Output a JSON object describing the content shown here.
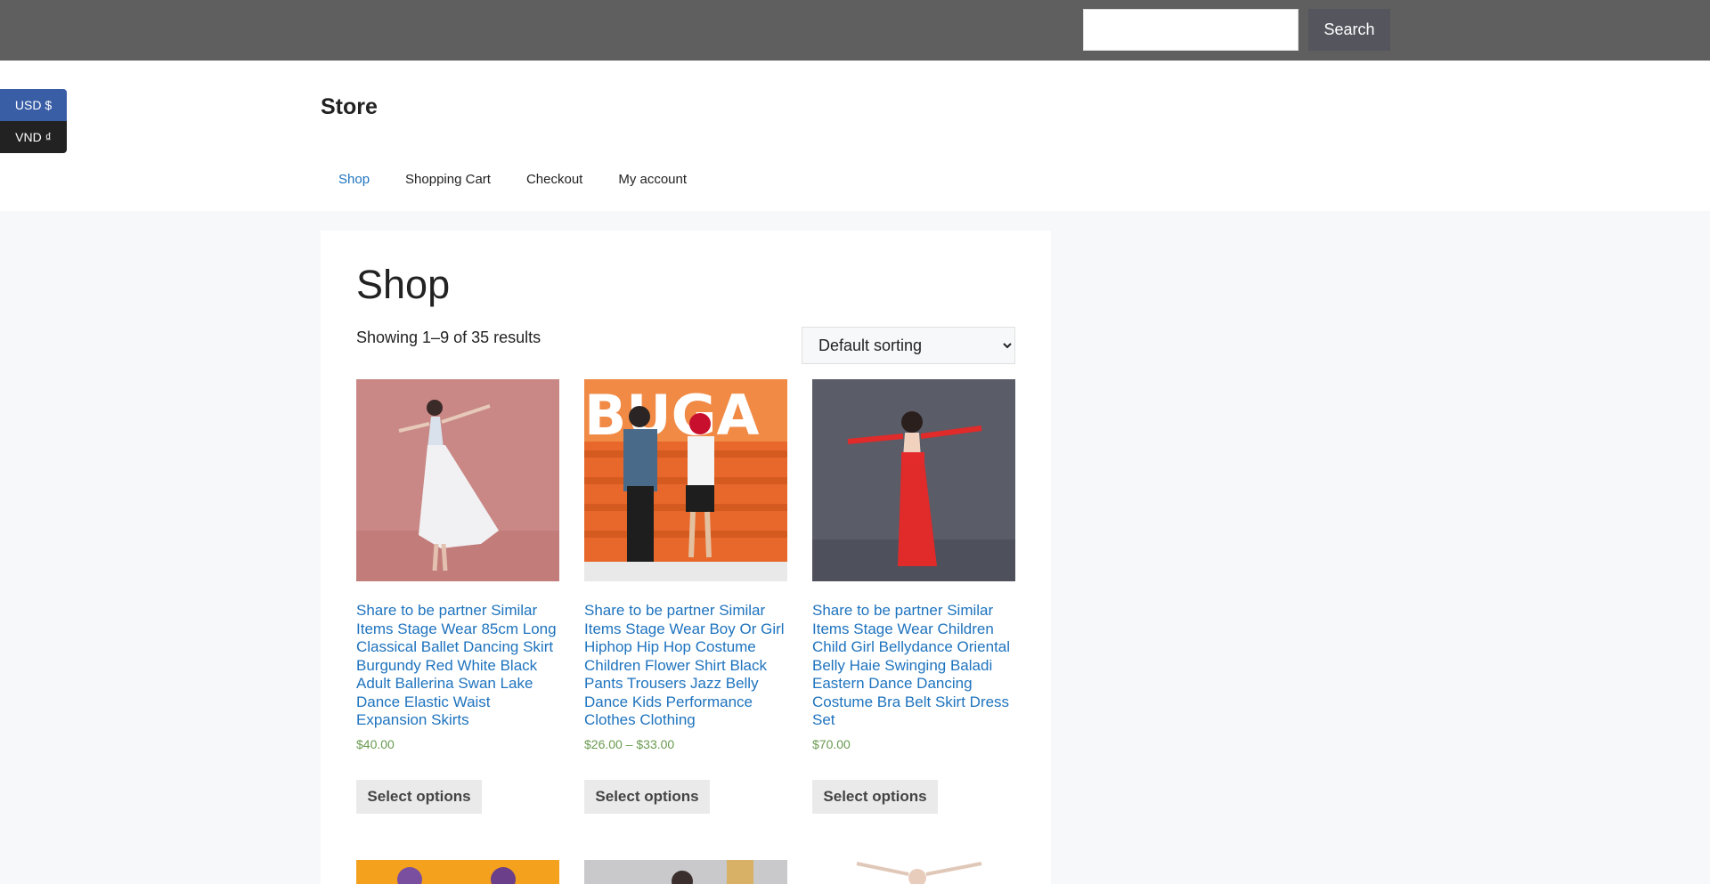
{
  "topbar": {
    "search_placeholder": "",
    "search_button": "Search"
  },
  "currency": {
    "usd": "USD $",
    "vnd": "VND ₫"
  },
  "header": {
    "site_title": "Store",
    "nav": [
      "Shop",
      "Shopping Cart",
      "Checkout",
      "My account"
    ]
  },
  "main": {
    "page_title": "Shop",
    "result_count": "Showing 1–9 of 35 results",
    "sorting_selected": "Default sorting"
  },
  "products": [
    {
      "title": "Share to be partner Similar Items Stage Wear 85cm Long Classical Ballet Dancing Skirt Burgundy Red White Black Adult Ballerina Swan Lake Dance Elastic Waist Expansion Skirts",
      "price": "$40.00",
      "button": "Select options"
    },
    {
      "title": "Share to be partner Similar Items Stage Wear Boy Or Girl Hiphop Hip Hop Costume Children Flower Shirt Black Pants Trousers Jazz Belly Dance Kids Performance Clothes Clothing",
      "price": "$26.00 – $33.00",
      "button": "Select options"
    },
    {
      "title": "Share to be partner Similar Items Stage Wear Children Child Girl Bellydance Oriental Belly Haie Swinging Baladi Eastern Dance Dancing Costume Bra Belt Skirt Dress Set",
      "price": "$70.00",
      "button": "Select options"
    }
  ],
  "colors": {
    "topbar": "#5f5f60",
    "link": "#1e73be",
    "price": "#6a9a50",
    "usd_bg": "#3a5ea6"
  }
}
